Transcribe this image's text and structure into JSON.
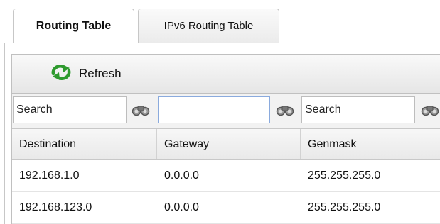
{
  "tabs": [
    {
      "label": "Routing Table",
      "active": true
    },
    {
      "label": "IPv6 Routing Table",
      "active": false
    }
  ],
  "toolbar": {
    "refresh_label": "Refresh",
    "refresh_icon": "refresh-arrows-icon",
    "icon_color": "#2e9a2e"
  },
  "filters": [
    {
      "placeholder": "Search",
      "value": ""
    },
    {
      "placeholder": "",
      "value": ""
    },
    {
      "placeholder": "Search",
      "value": ""
    }
  ],
  "filter_icon": "binoculars-icon",
  "columns": [
    "Destination",
    "Gateway",
    "Genmask"
  ],
  "rows": [
    [
      "192.168.1.0",
      "0.0.0.0",
      "255.255.255.0"
    ],
    [
      "192.168.123.0",
      "0.0.0.0",
      "255.255.255.0"
    ]
  ]
}
